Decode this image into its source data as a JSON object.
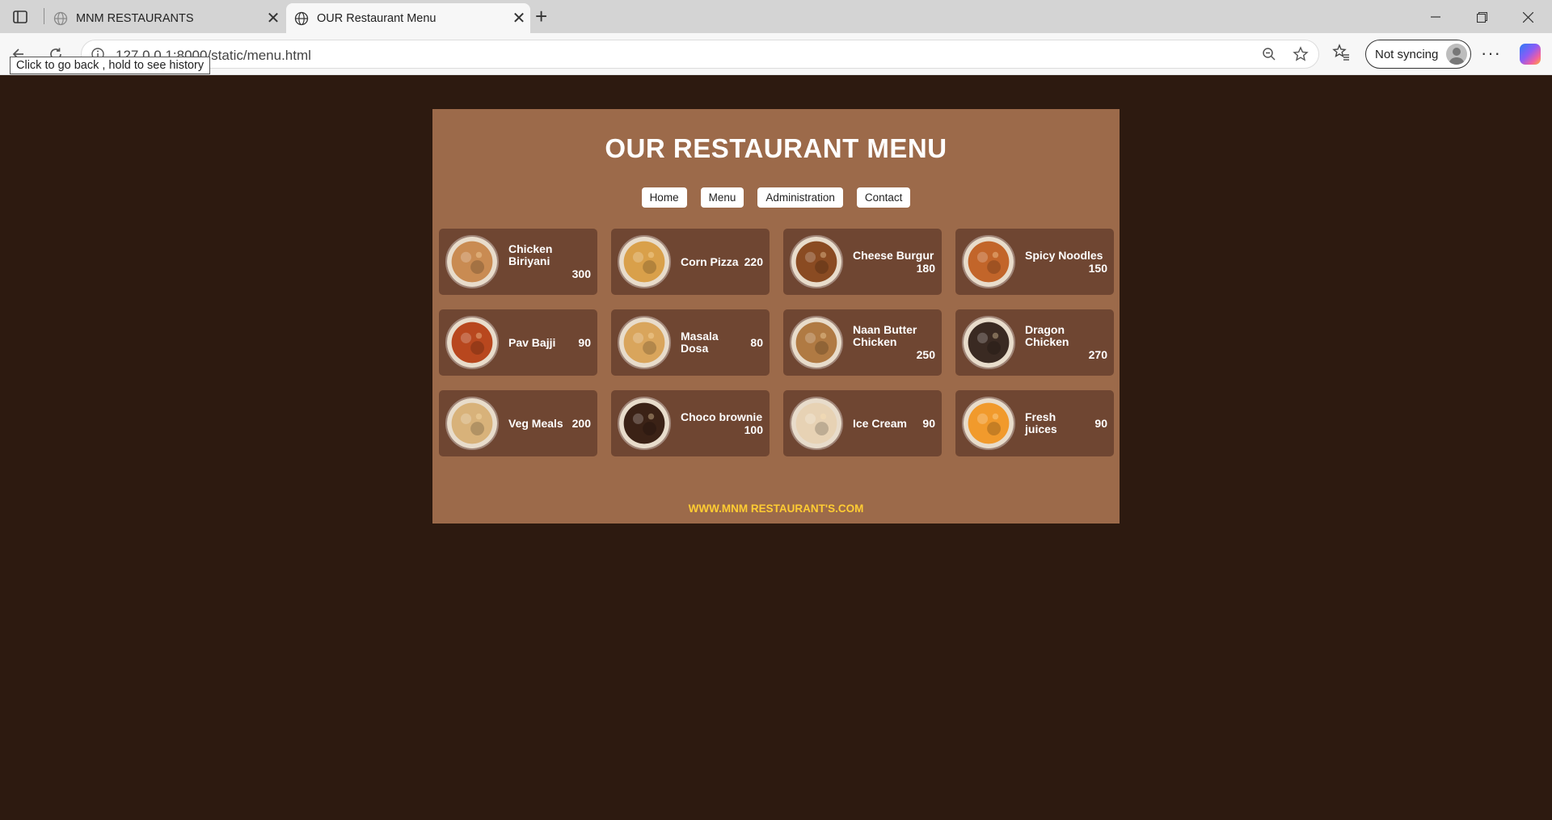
{
  "browser": {
    "tabs": [
      {
        "title": "MNM RESTAURANTS",
        "active": false
      },
      {
        "title": "OUR Restaurant Menu",
        "active": true
      }
    ],
    "url": "127.0.0.1:8000/static/menu.html",
    "url_visible": "static/menu.html",
    "sync_label": "Not syncing",
    "tooltip": "Click to go back , hold to see history"
  },
  "page": {
    "title": "OUR RESTAURANT MENU",
    "nav": [
      "Home",
      "Menu",
      "Administration",
      "Contact"
    ],
    "items": [
      {
        "name": "Chicken Biriyani",
        "price": "300",
        "icon": "biryani-bowl",
        "color": "#c98b52"
      },
      {
        "name": "Corn Pizza",
        "price": "220",
        "icon": "pizza",
        "color": "#d9a04a"
      },
      {
        "name": "Cheese Burgur",
        "price": "180",
        "icon": "burger",
        "color": "#8a4b22"
      },
      {
        "name": "Spicy Noodles",
        "price": "150",
        "icon": "noodles",
        "color": "#c2652a"
      },
      {
        "name": "Pav Bajji",
        "price": "90",
        "icon": "pav-bhaji",
        "color": "#b8471e"
      },
      {
        "name": "Masala Dosa",
        "price": "80",
        "icon": "dosa",
        "color": "#d9a55c"
      },
      {
        "name": "Naan Butter Chicken",
        "price": "250",
        "icon": "naan",
        "color": "#b07a43"
      },
      {
        "name": "Dragon Chicken",
        "price": "270",
        "icon": "dragon-chicken",
        "color": "#3a2a22"
      },
      {
        "name": "Veg Meals",
        "price": "200",
        "icon": "veg-meals",
        "color": "#d8b27a"
      },
      {
        "name": "Choco brownie",
        "price": "100",
        "icon": "brownie",
        "color": "#3b2216"
      },
      {
        "name": "Ice Cream",
        "price": "90",
        "icon": "ice-cream",
        "color": "#e7d2b4"
      },
      {
        "name": "Fresh juices",
        "price": "90",
        "icon": "juice",
        "color": "#f19a2c"
      }
    ],
    "footer": "WWW.MNM RESTAURANT'S.COM"
  },
  "colors": {
    "background": "#2d1a10",
    "panel": "#9c6a4a",
    "card": "#6f4632",
    "footer_text": "#ffcc33"
  }
}
